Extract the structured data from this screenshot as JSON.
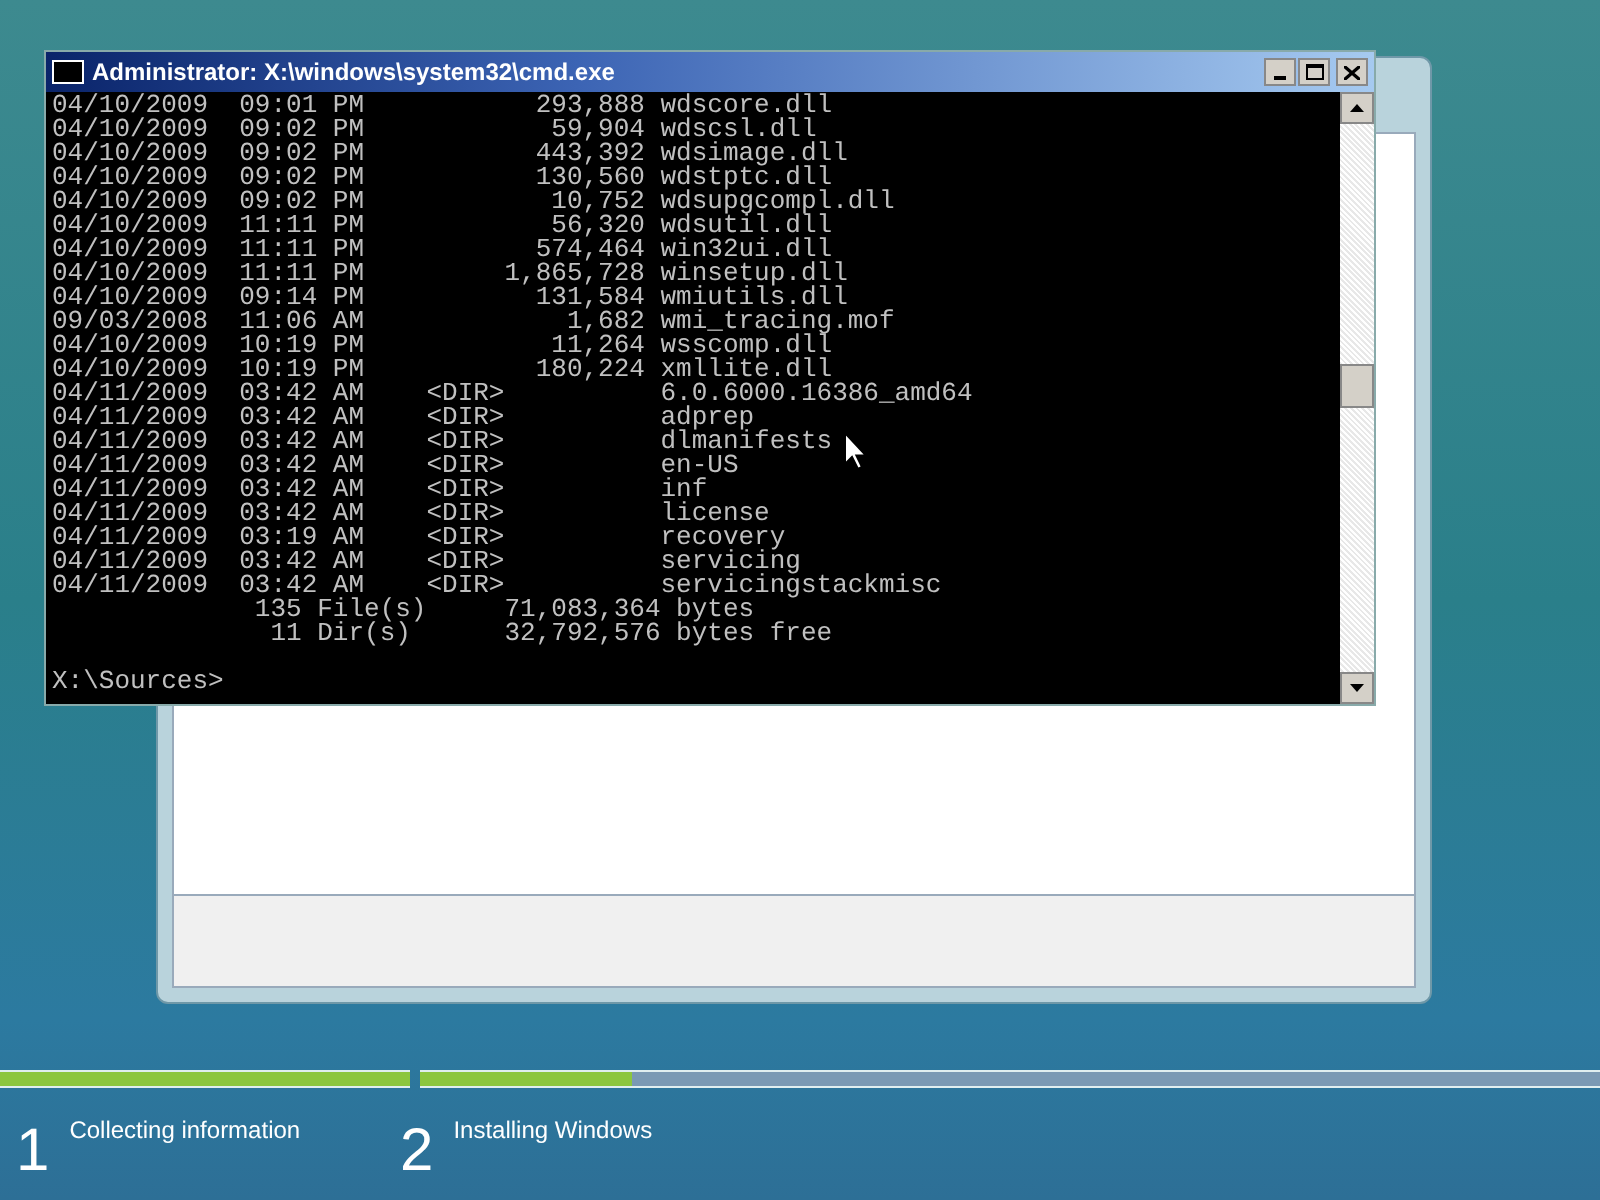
{
  "console_window": {
    "title": "Administrator: X:\\windows\\system32\\cmd.exe",
    "lines": [
      "04/10/2009  09:01 PM           293,888 wdscore.dll",
      "04/10/2009  09:02 PM            59,904 wdscsl.dll",
      "04/10/2009  09:02 PM           443,392 wdsimage.dll",
      "04/10/2009  09:02 PM           130,560 wdstptc.dll",
      "04/10/2009  09:02 PM            10,752 wdsupgcompl.dll",
      "04/10/2009  11:11 PM            56,320 wdsutil.dll",
      "04/10/2009  11:11 PM           574,464 win32ui.dll",
      "04/10/2009  11:11 PM         1,865,728 winsetup.dll",
      "04/10/2009  09:14 PM           131,584 wmiutils.dll",
      "09/03/2008  11:06 AM             1,682 wmi_tracing.mof",
      "04/10/2009  10:19 PM            11,264 wsscomp.dll",
      "04/10/2009  10:19 PM           180,224 xmllite.dll",
      "04/11/2009  03:42 AM    <DIR>          6.0.6000.16386_amd64",
      "04/11/2009  03:42 AM    <DIR>          adprep",
      "04/11/2009  03:42 AM    <DIR>          dlmanifests",
      "04/11/2009  03:42 AM    <DIR>          en-US",
      "04/11/2009  03:42 AM    <DIR>          inf",
      "04/11/2009  03:42 AM    <DIR>          license",
      "04/11/2009  03:19 AM    <DIR>          recovery",
      "04/11/2009  03:42 AM    <DIR>          servicing",
      "04/11/2009  03:42 AM    <DIR>          servicingstackmisc",
      "             135 File(s)     71,083,364 bytes",
      "              11 Dir(s)      32,792,576 bytes free"
    ],
    "prompt": "X:\\Sources>"
  },
  "progress": [
    {
      "level": 1
    },
    {
      "level": 0.18
    }
  ],
  "steps": [
    {
      "number": "1",
      "label": "Collecting information"
    },
    {
      "number": "2",
      "label": "Installing Windows"
    }
  ]
}
